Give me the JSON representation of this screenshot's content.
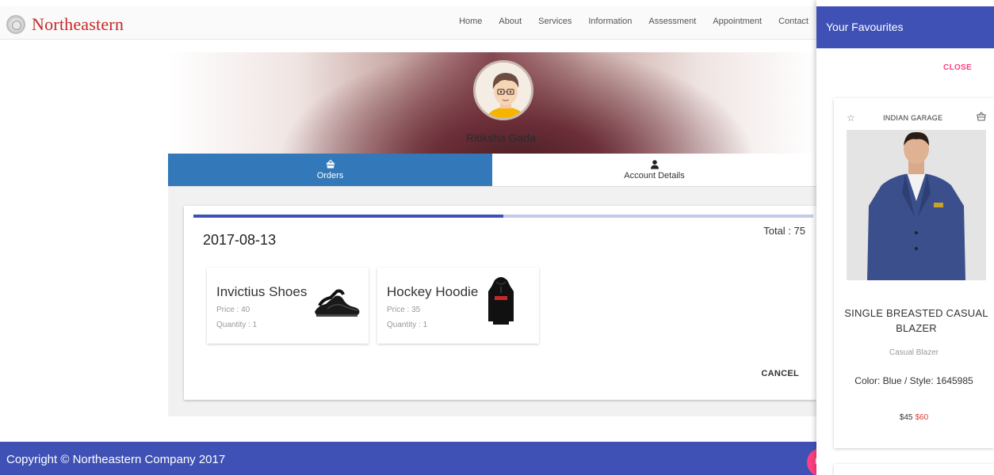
{
  "header": {
    "logo_text": "Northeastern",
    "nav": [
      "Home",
      "About",
      "Services",
      "Information",
      "Assessment",
      "Appointment",
      "Contact"
    ]
  },
  "profile": {
    "username": "Ritiksha Gada"
  },
  "tabs": [
    {
      "label": "Orders",
      "icon": "basket-icon",
      "active": true
    },
    {
      "label": "Account Details",
      "icon": "person-icon",
      "active": false
    }
  ],
  "order": {
    "date": "2017-08-13",
    "total": "Total : 75",
    "progress_fraction": 0.5,
    "items": [
      {
        "name": "Invictius Shoes",
        "price": "Price : 40",
        "quantity": "Quantity : 1",
        "image": "shoes-image"
      },
      {
        "name": "Hockey Hoodie",
        "price": "Price : 35",
        "quantity": "Quantity : 1",
        "image": "hoodie-image"
      }
    ],
    "cancel_label": "CANCEL"
  },
  "footer": {
    "text": "Copyright © Northeastern Company 2017",
    "fab_label": "F"
  },
  "drawer": {
    "title": "Your Favourites",
    "close_label": "CLOSE",
    "favourite": {
      "brand": "INDIAN GARAGE",
      "name": "SINGLE BREASTED CASUAL BLAZER",
      "category": "Casual Blazer",
      "color_style": "Color: Blue / Style: 1645985",
      "sale_price": "$45",
      "original_price": "$60"
    }
  },
  "colors": {
    "primary": "#3f51b5",
    "tab_active": "#3378b8",
    "accent": "#ff4081",
    "logo_red": "#c62828"
  }
}
